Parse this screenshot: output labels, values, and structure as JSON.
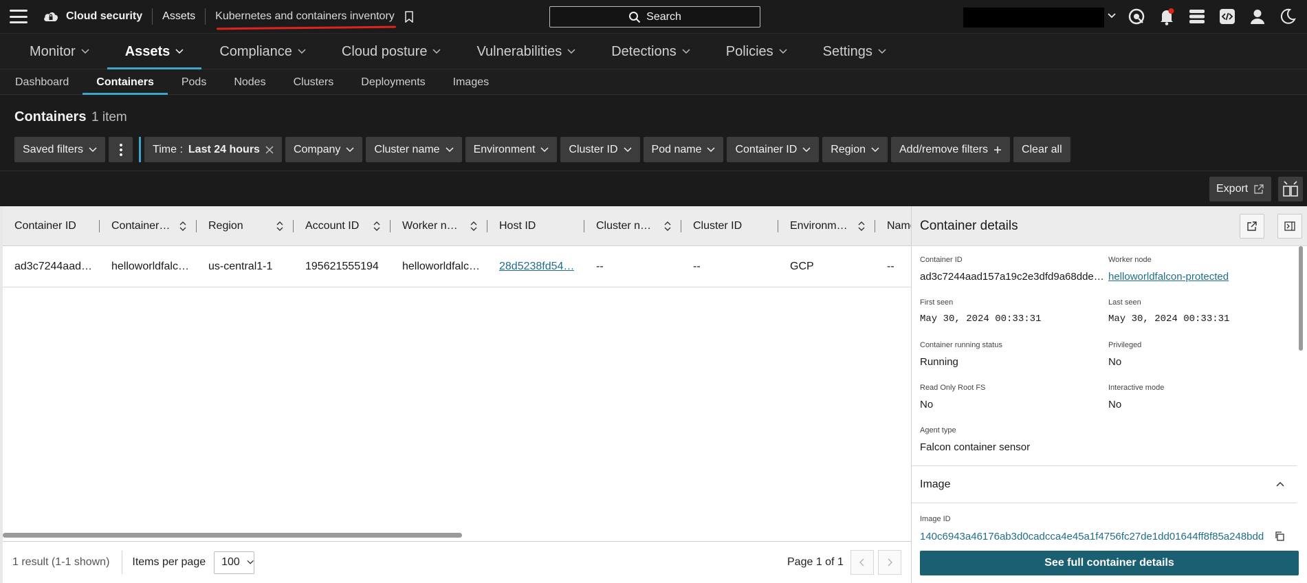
{
  "header": {
    "brand": "Cloud security",
    "crumb_assets": "Assets",
    "crumb_current": "Kubernetes and containers inventory",
    "search_label": "Search"
  },
  "main_nav": [
    {
      "label": "Monitor"
    },
    {
      "label": "Assets"
    },
    {
      "label": "Compliance"
    },
    {
      "label": "Cloud posture"
    },
    {
      "label": "Vulnerabilities"
    },
    {
      "label": "Detections"
    },
    {
      "label": "Policies"
    },
    {
      "label": "Settings"
    }
  ],
  "sub_nav": [
    {
      "label": "Dashboard"
    },
    {
      "label": "Containers"
    },
    {
      "label": "Pods"
    },
    {
      "label": "Nodes"
    },
    {
      "label": "Clusters"
    },
    {
      "label": "Deployments"
    },
    {
      "label": "Images"
    }
  ],
  "page": {
    "title": "Containers",
    "count": "1 item"
  },
  "filters": {
    "saved_filters": "Saved filters",
    "time_label": "Time :",
    "time_value": "Last 24 hours",
    "company": "Company",
    "cluster_name": "Cluster name",
    "environment": "Environment",
    "cluster_id": "Cluster ID",
    "pod_name": "Pod name",
    "container_id": "Container ID",
    "region": "Region",
    "add_remove": "Add/remove filters",
    "clear_all": "Clear all"
  },
  "toolbar": {
    "export": "Export"
  },
  "table": {
    "columns": [
      "Container ID",
      "Container…",
      "Region",
      "Account ID",
      "Worker n…",
      "Host ID",
      "Cluster n…",
      "Cluster ID",
      "Environm…",
      "Name"
    ],
    "rows": [
      [
        "ad3c7244aad…",
        "helloworldfalc…",
        "us-central1-1",
        "195621555194",
        "helloworldfalc…",
        "28d5238fd54…",
        "--",
        "--",
        "GCP",
        "--"
      ]
    ]
  },
  "footer": {
    "result": "1 result (1-1 shown)",
    "items_per_page": "Items per page",
    "items_per_page_value": "100",
    "page_info": "Page 1 of 1"
  },
  "details": {
    "title": "Container details",
    "container_id_label": "Container ID",
    "container_id": "ad3c7244aad157a19c2e3dfd9a68dde…",
    "worker_node_label": "Worker node",
    "worker_node": "helloworldfalcon-protected",
    "first_seen_label": "First seen",
    "first_seen": "May 30, 2024 00:33:31",
    "last_seen_label": "Last seen",
    "last_seen": "May 30, 2024 00:33:31",
    "running_status_label": "Container running status",
    "running_status": "Running",
    "privileged_label": "Privileged",
    "privileged": "No",
    "read_only_label": "Read Only Root FS",
    "read_only": "No",
    "interactive_label": "Interactive mode",
    "interactive": "No",
    "agent_type_label": "Agent type",
    "agent_type": "Falcon container sensor",
    "image_section": "Image",
    "image_id_label": "Image ID",
    "image_id": "140c6943a46176ab3d0cadcca4e45a1f4756fc27de1dd01644ff8f85a248bdd",
    "full_details_button": "See full container details"
  },
  "colors": {
    "accent": "#3ba6c9",
    "link": "#1f6e8c",
    "primary_button": "#1a5f72",
    "highlight_underline": "#e0231c",
    "notification": "#e0231c"
  }
}
